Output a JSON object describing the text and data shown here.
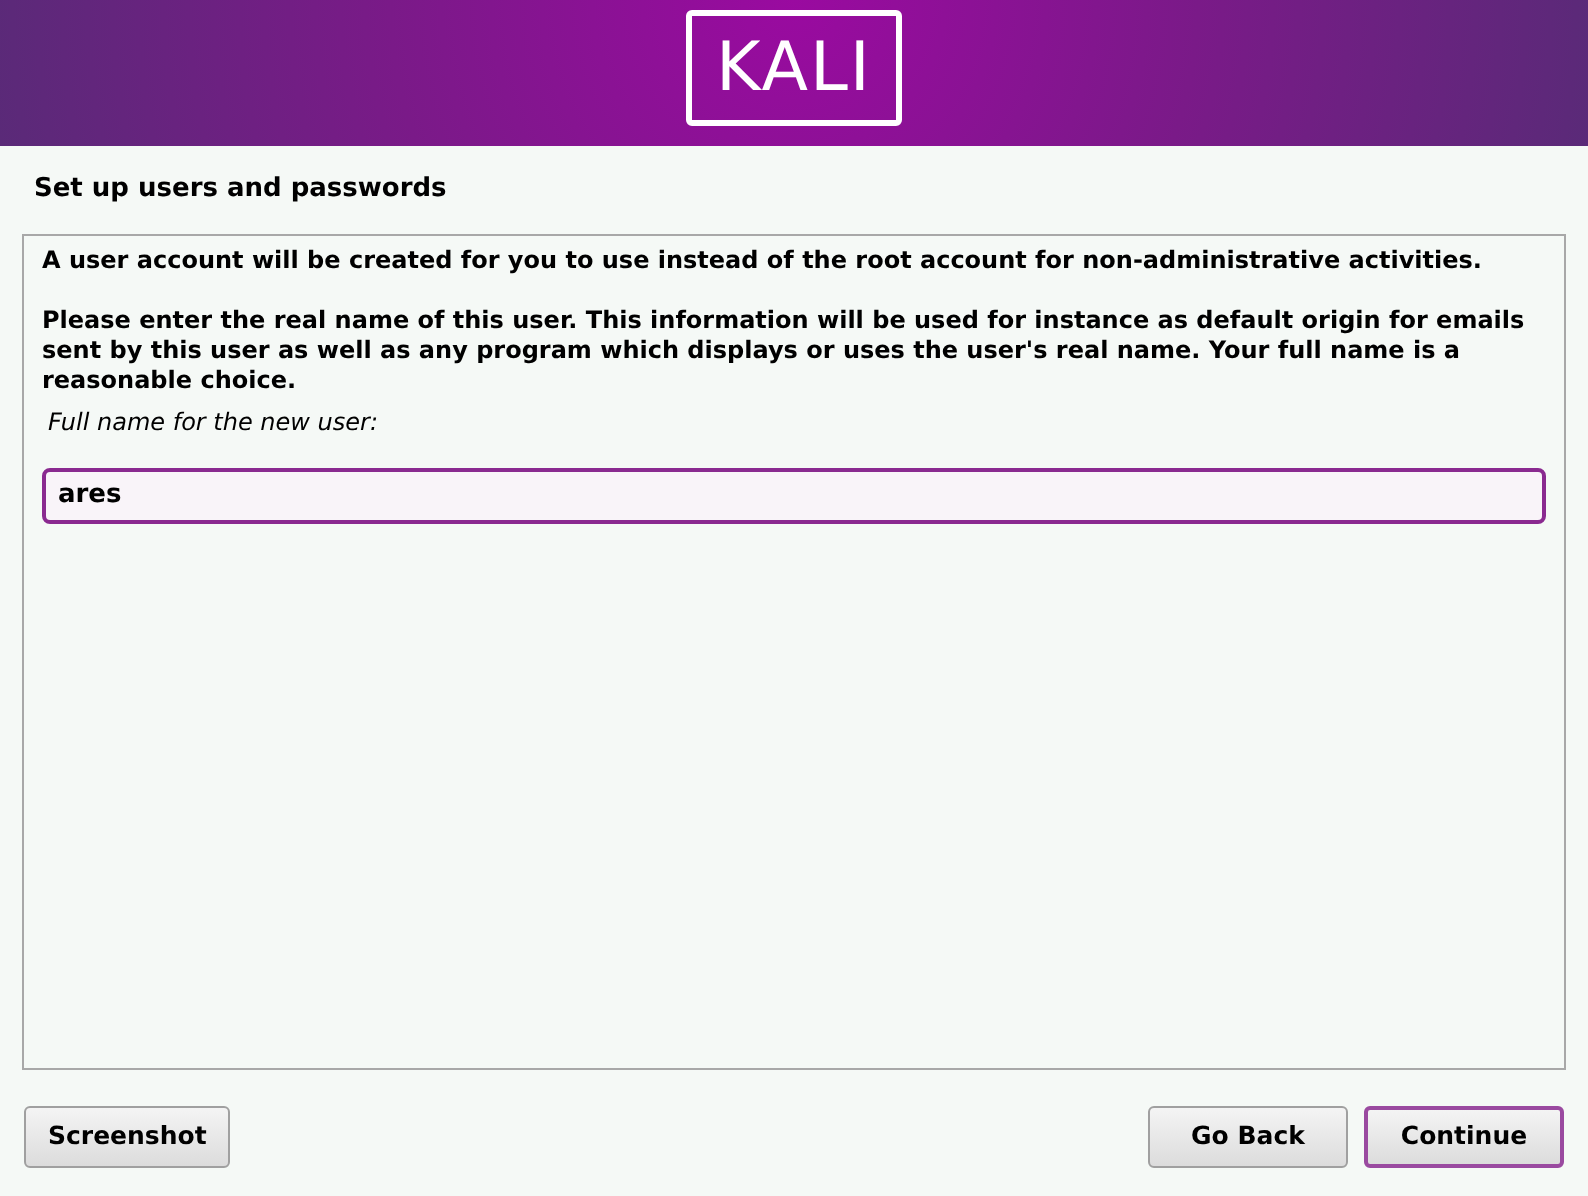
{
  "banner": {
    "logo": "KALI"
  },
  "title": "Set up users and passwords",
  "intro": "A user account will be created for you to use instead of the root account for non-administrative activities.",
  "description": "Please enter the real name of this user. This information will be used for instance as default origin for emails sent by this user as well as any program which displays or uses the user's real name. Your full name is a reasonable choice.",
  "field": {
    "label": "Full name for the new user:",
    "value": "ares",
    "focused": true
  },
  "left_buttons": [
    {
      "label": "Screenshot",
      "focused": false
    }
  ],
  "right_buttons": [
    {
      "label": "Go Back",
      "focused": false
    },
    {
      "label": "Continue",
      "focused": true
    }
  ]
}
